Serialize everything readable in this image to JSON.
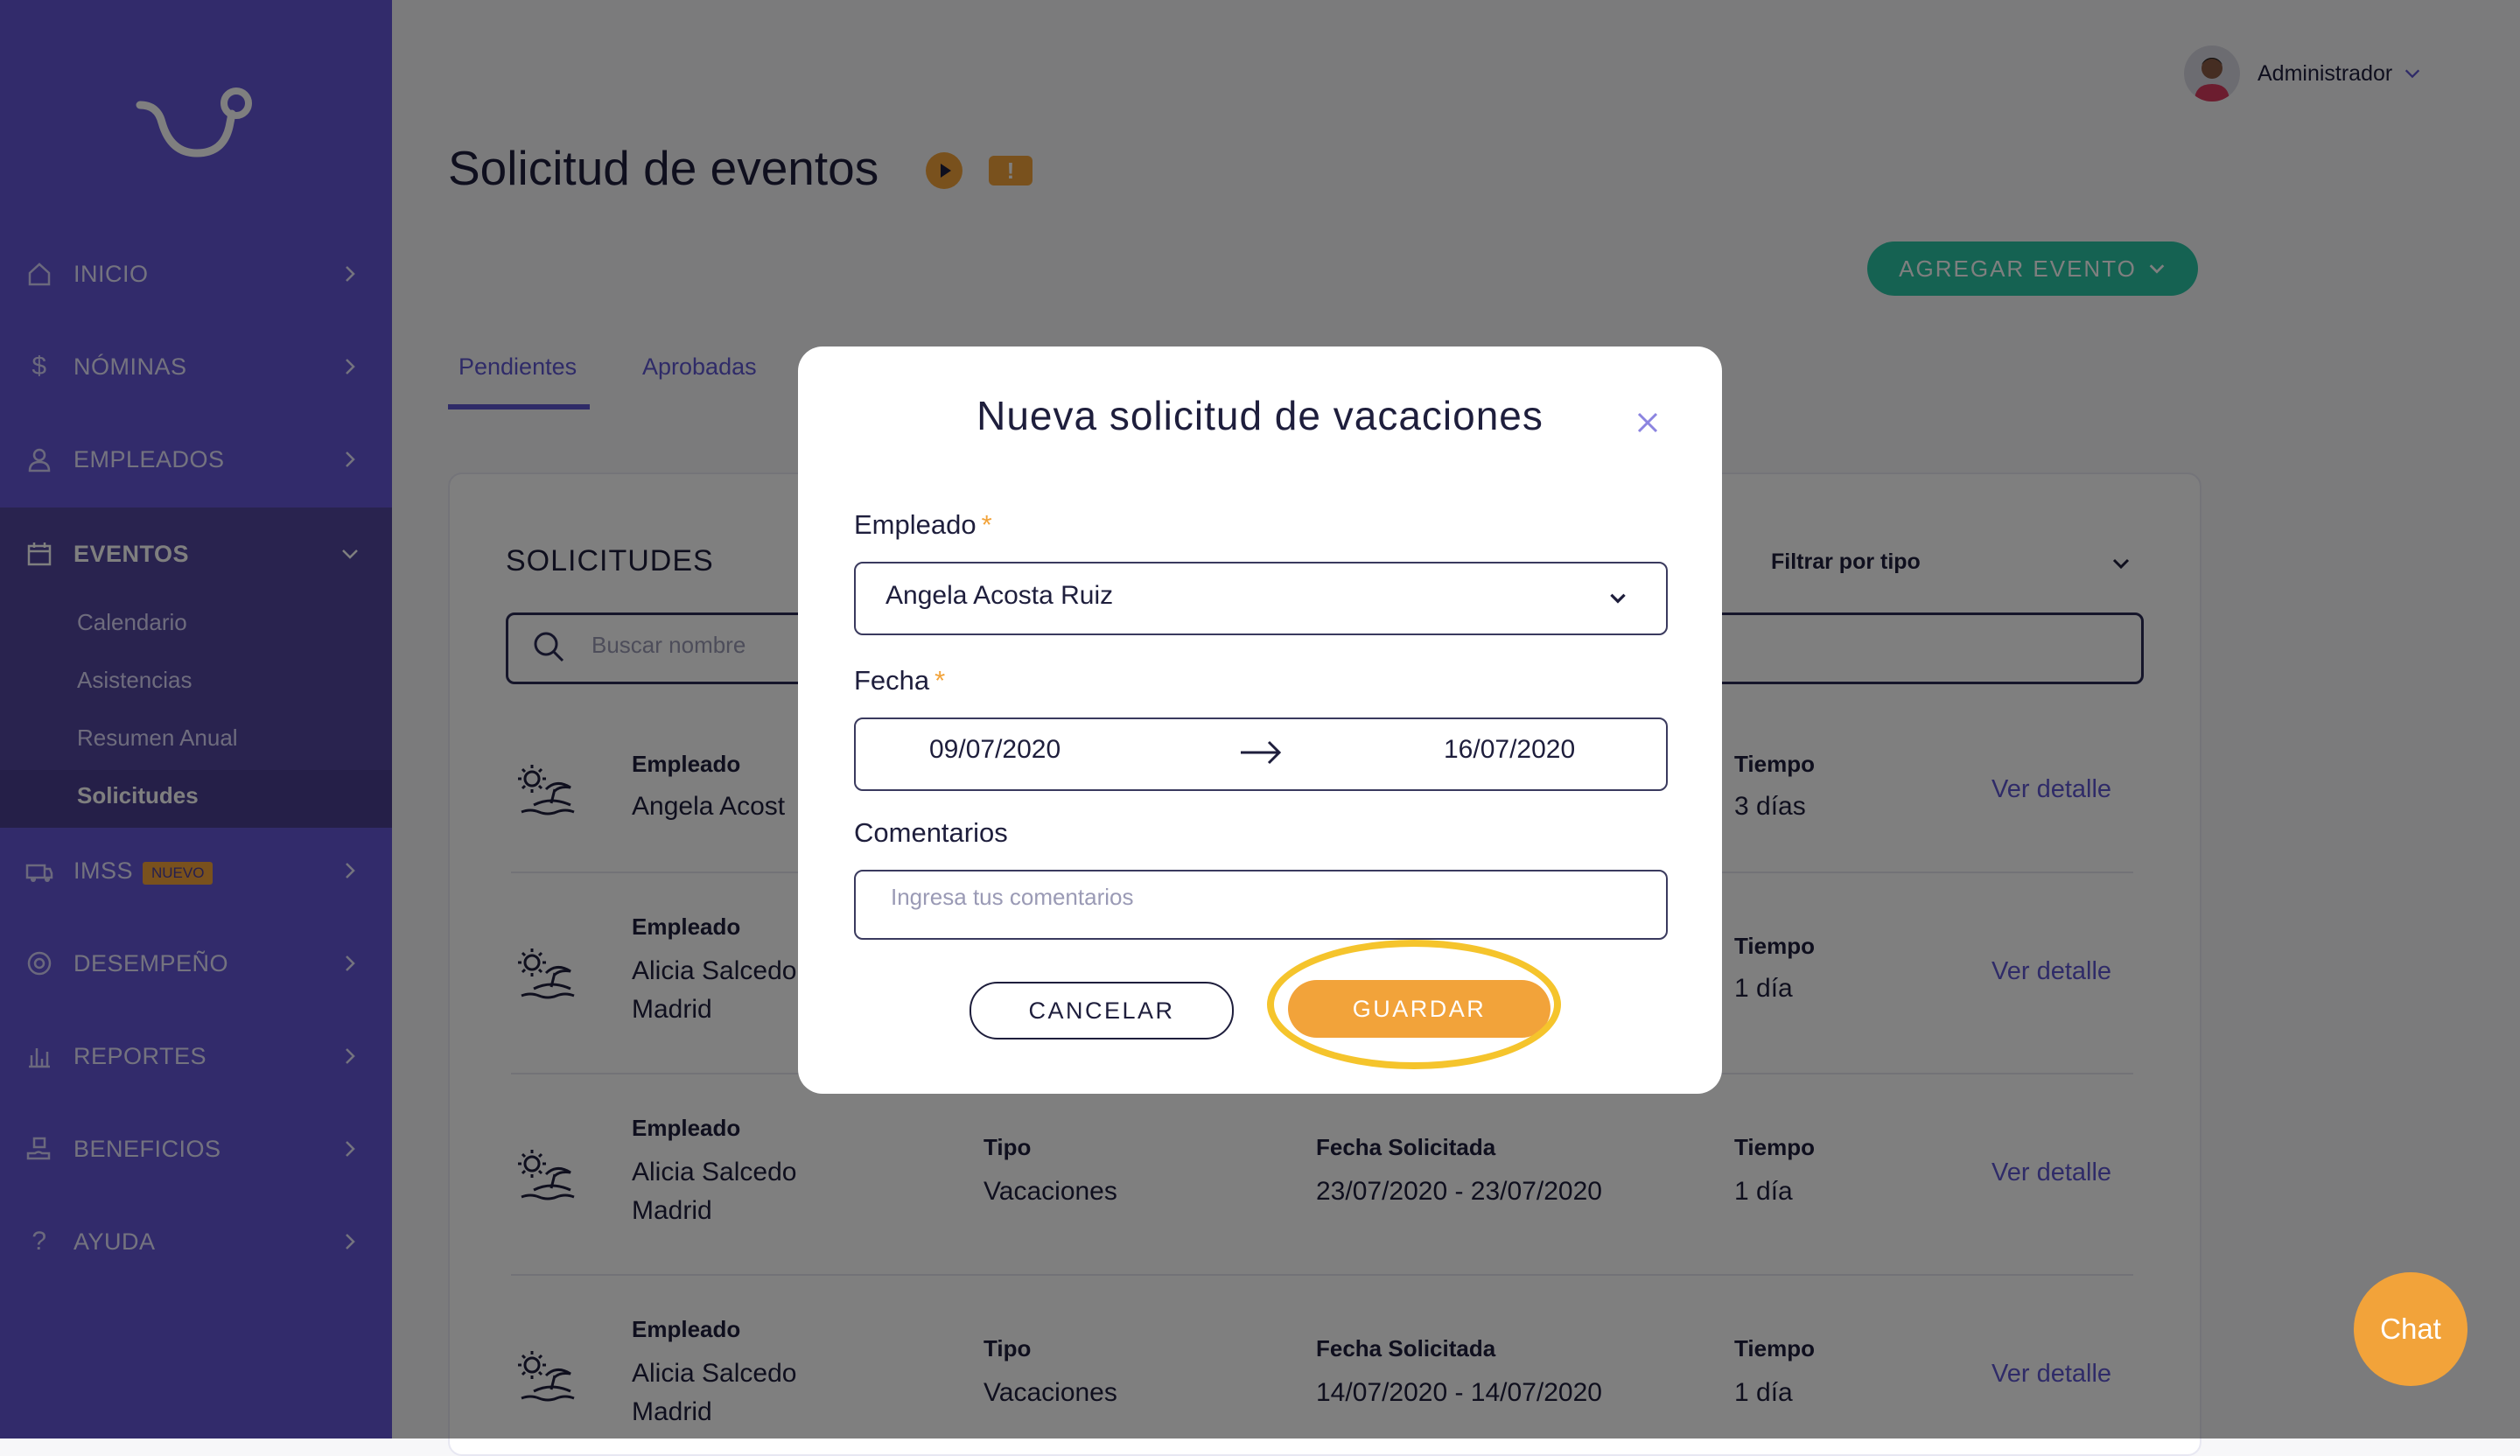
{
  "sidebar": {
    "items": [
      {
        "label": "INICIO",
        "icon": "home-icon"
      },
      {
        "label": "NÓMINAS",
        "icon": "dollar-icon"
      },
      {
        "label": "EMPLEADOS",
        "icon": "user-icon"
      },
      {
        "label": "EVENTOS",
        "icon": "calendar-icon"
      },
      {
        "label": "IMSS",
        "icon": "ambulance-icon",
        "badge": "NUEVO"
      },
      {
        "label": "DESEMPEÑO",
        "icon": "target-icon"
      },
      {
        "label": "REPORTES",
        "icon": "bar-chart-icon"
      },
      {
        "label": "BENEFICIOS",
        "icon": "hand-gift-icon"
      },
      {
        "label": "AYUDA",
        "icon": "question-icon"
      }
    ],
    "subitems": [
      "Calendario",
      "Asistencias",
      "Resumen Anual",
      "Solicitudes"
    ],
    "active_item": "EVENTOS",
    "selected_subitem": "Solicitudes"
  },
  "header": {
    "title": "Solicitud de eventos",
    "user_name": "Administrador",
    "add_button": "AGREGAR EVENTO"
  },
  "tabs": [
    "Pendientes",
    "Aprobadas"
  ],
  "content": {
    "section_title": "SOLICITUDES",
    "filter_label": "Filtrar por tipo",
    "search_placeholder": "Buscar nombre",
    "columns": {
      "employee": "Empleado",
      "type": "Tipo",
      "date": "Fecha Solicitada",
      "time": "Tiempo"
    },
    "link_label": "Ver detalle",
    "rows": [
      {
        "employee": "Angela Acost",
        "type": "",
        "date": "",
        "time": "3 días"
      },
      {
        "employee_line1": "Alicia Salcedo",
        "employee_line2": "Madrid",
        "type": "",
        "date": "",
        "time": "1 día"
      },
      {
        "employee_line1": "Alicia Salcedo",
        "employee_line2": "Madrid",
        "type": "Vacaciones",
        "date": "23/07/2020 - 23/07/2020",
        "time": "1 día"
      },
      {
        "employee_line1": "Alicia Salcedo",
        "employee_line2": "Madrid",
        "type": "Vacaciones",
        "date": "14/07/2020 - 14/07/2020",
        "time": "1 día"
      }
    ]
  },
  "modal": {
    "title": "Nueva solicitud de vacaciones",
    "employee_label": "Empleado",
    "required_mark": "*",
    "employee_value": "Angela Acosta Ruiz",
    "date_label": "Fecha",
    "date_from": "09/07/2020",
    "date_to": "16/07/2020",
    "comments_label": "Comentarios",
    "comments_placeholder": "Ingresa tus comentarios",
    "cancel_label": "CANCELAR",
    "save_label": "GUARDAR"
  },
  "chat_label": "Chat",
  "colors": {
    "sidebar": "#6457d6",
    "accent": "#5f56d0",
    "orange": "#f2a33a",
    "green": "#2bc4a4",
    "highlight": "#f5c42c"
  }
}
